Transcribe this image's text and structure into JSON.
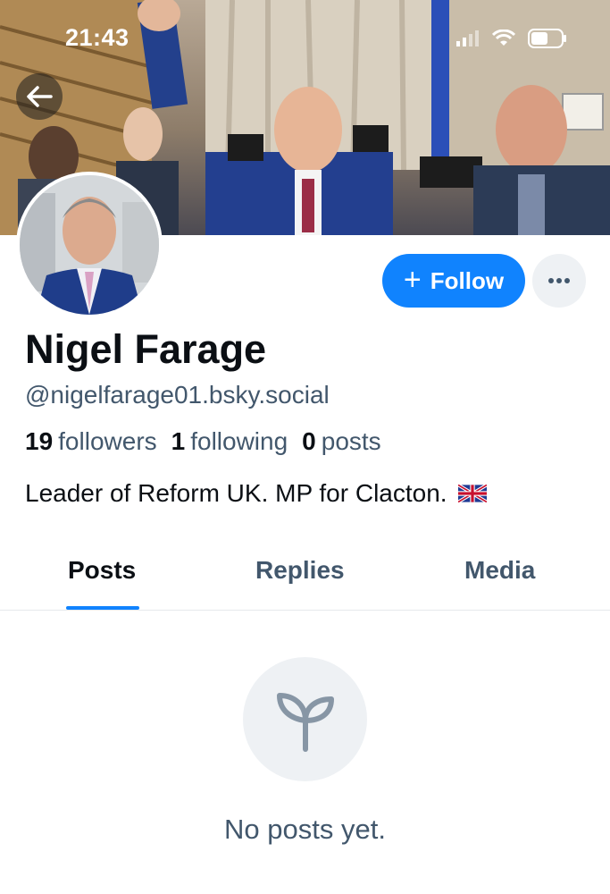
{
  "status_bar": {
    "time": "21:43"
  },
  "banner": {
    "image": "crowd-photo-cover"
  },
  "profile": {
    "display_name": "Nigel Farage",
    "handle": "@nigelfarage01.bsky.social",
    "stats": {
      "followers_count": "19",
      "followers_label": "followers",
      "following_count": "1",
      "following_label": "following",
      "posts_count": "0",
      "posts_label": "posts"
    },
    "bio": "Leader of Reform UK. MP for Clacton.",
    "bio_flag": "🇬🇧"
  },
  "actions": {
    "follow_plus": "+",
    "follow_label": "Follow",
    "more_icon": "ellipsis-icon"
  },
  "tabs": [
    {
      "label": "Posts",
      "active": true
    },
    {
      "label": "Replies",
      "active": false
    },
    {
      "label": "Media",
      "active": false
    }
  ],
  "empty_state": {
    "icon": "seedling-icon",
    "message": "No posts yet."
  },
  "colors": {
    "accent": "#1083fe",
    "muted_text": "#42576c",
    "text": "#0b0f14",
    "surface": "#eef1f4"
  }
}
